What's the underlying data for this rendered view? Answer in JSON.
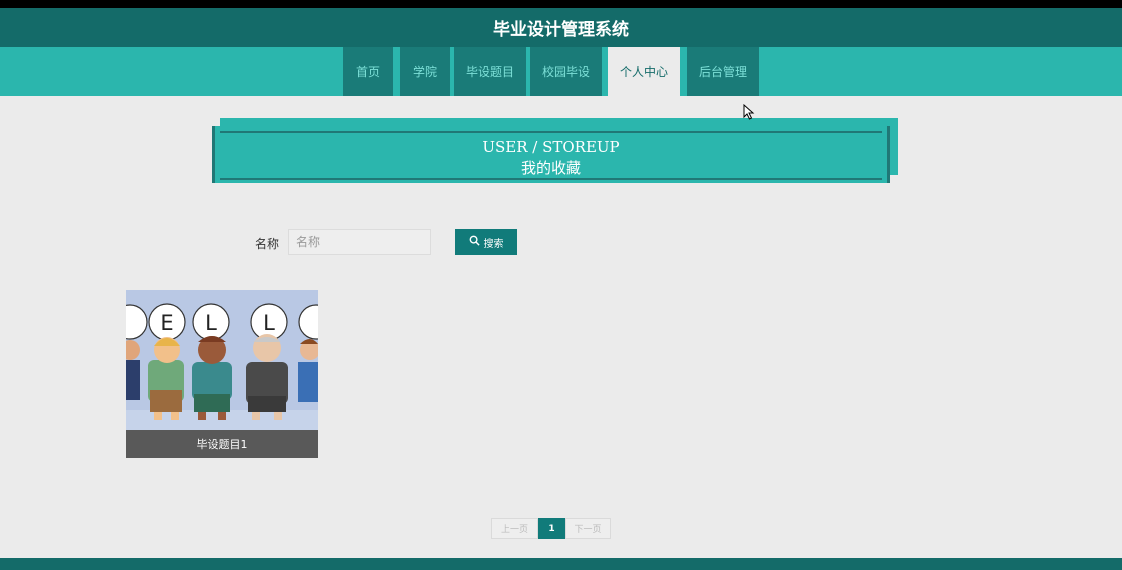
{
  "header": {
    "title": "毕业设计管理系统"
  },
  "nav": {
    "items": [
      {
        "label": "首页"
      },
      {
        "label": "学院"
      },
      {
        "label": "毕设题目"
      },
      {
        "label": "校园毕设"
      },
      {
        "label": "个人中心"
      },
      {
        "label": "后台管理"
      }
    ],
    "active": "个人中心"
  },
  "banner": {
    "en": "USER / STOREUP",
    "cn": "我的收藏"
  },
  "search": {
    "label": "名称",
    "placeholder": "名称",
    "value": "",
    "button_label": "搜索",
    "button_icon": "search-icon"
  },
  "cards": [
    {
      "title": "毕设题目1",
      "image_letters": [
        "E",
        "L",
        "L"
      ]
    }
  ],
  "pagination": {
    "prev": "上一页",
    "current": "1",
    "next": "下一页"
  },
  "colors": {
    "header": "#146b69",
    "nav_bar": "#2bb6ad",
    "nav_item": "#1a7b78",
    "accent": "#117b7a",
    "background": "#ebebeb"
  }
}
